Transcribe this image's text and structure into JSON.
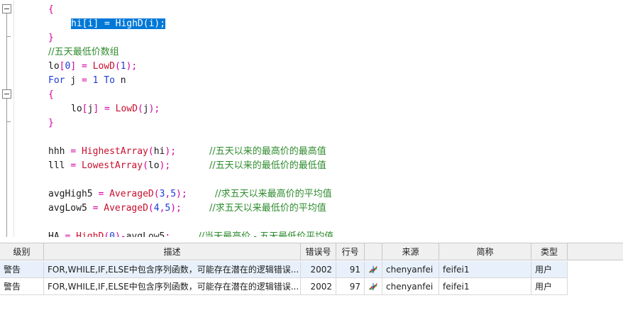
{
  "editor": {
    "lines": [
      [
        {
          "t": "{",
          "c": "pun"
        }
      ],
      [
        {
          "t": "hi",
          "c": "id"
        },
        {
          "t": "[",
          "c": "pun"
        },
        {
          "t": "i",
          "c": "id"
        },
        {
          "t": "]",
          "c": "pun"
        },
        {
          "t": " = ",
          "c": "pun"
        },
        {
          "t": "HighD",
          "c": "fn"
        },
        {
          "t": "(",
          "c": "pun"
        },
        {
          "t": "i",
          "c": "id"
        },
        {
          "t": ");",
          "c": "pun"
        }
      ],
      [
        {
          "t": "}",
          "c": "pun"
        }
      ],
      [
        {
          "t": "//五天最低价数组",
          "c": "cm"
        }
      ],
      [
        {
          "t": "lo",
          "c": "id"
        },
        {
          "t": "[",
          "c": "pun"
        },
        {
          "t": "0",
          "c": "num"
        },
        {
          "t": "]",
          "c": "pun"
        },
        {
          "t": " = ",
          "c": "pun"
        },
        {
          "t": "LowD",
          "c": "fn"
        },
        {
          "t": "(",
          "c": "pun"
        },
        {
          "t": "1",
          "c": "num"
        },
        {
          "t": ");",
          "c": "pun"
        }
      ],
      [
        {
          "t": "For",
          "c": "kw"
        },
        {
          "t": " j ",
          "c": "id"
        },
        {
          "t": "=",
          "c": "pun"
        },
        {
          "t": " 1 ",
          "c": "num"
        },
        {
          "t": "To",
          "c": "kw"
        },
        {
          "t": " n",
          "c": "id"
        }
      ],
      [
        {
          "t": "{",
          "c": "pun"
        }
      ],
      [
        {
          "t": "lo",
          "c": "id"
        },
        {
          "t": "[",
          "c": "pun"
        },
        {
          "t": "j",
          "c": "id"
        },
        {
          "t": "]",
          "c": "pun"
        },
        {
          "t": " = ",
          "c": "pun"
        },
        {
          "t": "LowD",
          "c": "fn"
        },
        {
          "t": "(",
          "c": "pun"
        },
        {
          "t": "j",
          "c": "id"
        },
        {
          "t": ");",
          "c": "pun"
        }
      ],
      [
        {
          "t": "}",
          "c": "pun"
        }
      ],
      [],
      [
        {
          "t": "hhh ",
          "c": "id"
        },
        {
          "t": "= ",
          "c": "pun"
        },
        {
          "t": "HighestArray",
          "c": "fn"
        },
        {
          "t": "(",
          "c": "pun"
        },
        {
          "t": "hi",
          "c": "id"
        },
        {
          "t": ");",
          "c": "pun"
        },
        {
          "t": "      ",
          "c": "id"
        },
        {
          "t": "//五天以来的最高价的最高值",
          "c": "cm"
        }
      ],
      [
        {
          "t": "lll ",
          "c": "id"
        },
        {
          "t": "= ",
          "c": "pun"
        },
        {
          "t": "LowestArray",
          "c": "fn"
        },
        {
          "t": "(",
          "c": "pun"
        },
        {
          "t": "lo",
          "c": "id"
        },
        {
          "t": ");",
          "c": "pun"
        },
        {
          "t": "       ",
          "c": "id"
        },
        {
          "t": "//五天以来的最低价的最低值",
          "c": "cm"
        }
      ],
      [],
      [
        {
          "t": "avgHigh5 ",
          "c": "id"
        },
        {
          "t": "= ",
          "c": "pun"
        },
        {
          "t": "AverageD",
          "c": "fn"
        },
        {
          "t": "(",
          "c": "pun"
        },
        {
          "t": "3",
          "c": "num"
        },
        {
          "t": ",",
          "c": "pun"
        },
        {
          "t": "5",
          "c": "num"
        },
        {
          "t": ");",
          "c": "pun"
        },
        {
          "t": "     ",
          "c": "id"
        },
        {
          "t": "//求五天以来最高价的平均值",
          "c": "cm"
        }
      ],
      [
        {
          "t": "avgLow5 ",
          "c": "id"
        },
        {
          "t": "= ",
          "c": "pun"
        },
        {
          "t": "AverageD",
          "c": "fn"
        },
        {
          "t": "(",
          "c": "pun"
        },
        {
          "t": "4",
          "c": "num"
        },
        {
          "t": ",",
          "c": "pun"
        },
        {
          "t": "5",
          "c": "num"
        },
        {
          "t": ");",
          "c": "pun"
        },
        {
          "t": "     ",
          "c": "id"
        },
        {
          "t": "//求五天以来最低价的平均值",
          "c": "cm"
        }
      ],
      [],
      [
        {
          "t": "HA ",
          "c": "id"
        },
        {
          "t": "= ",
          "c": "pun"
        },
        {
          "t": "HighD",
          "c": "fn"
        },
        {
          "t": "(",
          "c": "pun"
        },
        {
          "t": "0",
          "c": "num"
        },
        {
          "t": ")-",
          "c": "pun"
        },
        {
          "t": "avgLow5",
          "c": "id"
        },
        {
          "t": ";",
          "c": "pun"
        },
        {
          "t": "     ",
          "c": "id"
        },
        {
          "t": "//当天最高价 - 五天最低价平均值",
          "c": "cm"
        }
      ]
    ],
    "indents": [
      1,
      2,
      1,
      1,
      1,
      1,
      1,
      2,
      1,
      0,
      1,
      1,
      0,
      1,
      1,
      0,
      1
    ],
    "highlighted_line": 1
  },
  "messages": {
    "columns": [
      "级别",
      "描述",
      "错误号",
      "行号",
      "",
      "来源",
      "简称",
      "类型"
    ],
    "rows": [
      {
        "level": "警告",
        "description": "FOR,WHILE,IF,ELSE中包含序列函数，可能存在潜在的逻辑错误...",
        "error_code": "2002",
        "line": "91",
        "icon": "chart-trend-icon",
        "source": "chenyanfei",
        "short_name": "feifei1",
        "type": "用户"
      },
      {
        "level": "警告",
        "description": "FOR,WHILE,IF,ELSE中包含序列函数，可能存在潜在的逻辑错误...",
        "error_code": "2002",
        "line": "97",
        "icon": "chart-trend-icon",
        "source": "chenyanfei",
        "short_name": "feifei1",
        "type": "用户"
      }
    ]
  }
}
